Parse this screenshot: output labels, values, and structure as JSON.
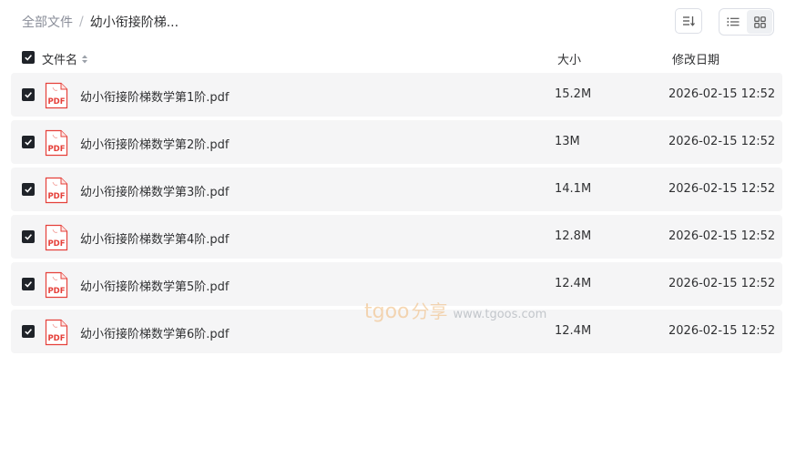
{
  "breadcrumb": {
    "root": "全部文件",
    "separator": "/",
    "current": "幼小衔接阶梯..."
  },
  "toolbar": {
    "sort_icon": "sort-icon",
    "view_list_icon": "list-view-icon",
    "view_grid_icon": "grid-view-icon",
    "active_view": "list"
  },
  "table": {
    "header": {
      "name": "文件名",
      "size": "大小",
      "date": "修改日期"
    },
    "all_selected": true,
    "rows": [
      {
        "name": "幼小衔接阶梯数学第1阶.pdf",
        "size": "15.2M",
        "date": "2026-02-15 12:52",
        "icon": "pdf-icon",
        "checked": true
      },
      {
        "name": "幼小衔接阶梯数学第2阶.pdf",
        "size": "13M",
        "date": "2026-02-15 12:52",
        "icon": "pdf-icon",
        "checked": true
      },
      {
        "name": "幼小衔接阶梯数学第3阶.pdf",
        "size": "14.1M",
        "date": "2026-02-15 12:52",
        "icon": "pdf-icon",
        "checked": true
      },
      {
        "name": "幼小衔接阶梯数学第4阶.pdf",
        "size": "12.8M",
        "date": "2026-02-15 12:52",
        "icon": "pdf-icon",
        "checked": true
      },
      {
        "name": "幼小衔接阶梯数学第5阶.pdf",
        "size": "12.4M",
        "date": "2026-02-15 12:52",
        "icon": "pdf-icon",
        "checked": true
      },
      {
        "name": "幼小衔接阶梯数学第6阶.pdf",
        "size": "12.4M",
        "date": "2026-02-15 12:52",
        "icon": "pdf-icon",
        "checked": true
      }
    ]
  },
  "pdf_icon_label": "PDF",
  "watermark": {
    "logo": "tgoo",
    "cn": "分享",
    "url": "www.tgoos.com"
  },
  "colors": {
    "row_background": "#f5f5f6",
    "checkbox": "#1f2329",
    "pdf_red": "#e5403a",
    "watermark_orange": "#f0b978"
  }
}
